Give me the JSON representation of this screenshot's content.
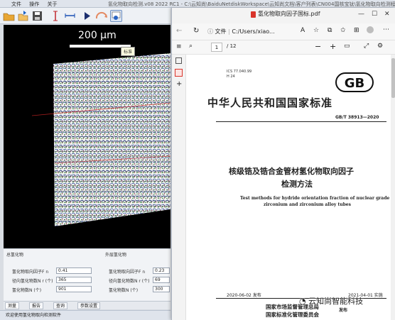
{
  "app": {
    "menu": [
      "文件",
      "操作",
      "关于"
    ],
    "title": "氢化物取向检测.v08 2022 RC1 - C:\\云知尚\\BaiduNetdiskWorkspace\\云知尚文档\\客户列表\\CN004国核宝钛\\氢化物取向检测程序RT...",
    "tooltip": "标准",
    "scalebar_label": "200 µm",
    "left_group": {
      "title": "总氢化物",
      "fields": [
        {
          "label": "氢化物取向因子F n",
          "value": "0.41"
        },
        {
          "label": "径向氢化物数N r (个)",
          "value": "365"
        },
        {
          "label": "氢化物数N (个)",
          "value": "901"
        }
      ]
    },
    "right_group": {
      "title": "外层氢化物",
      "fields": [
        {
          "label": "氢化物取向因子F n",
          "value": "0.23"
        },
        {
          "label": "径向氢化物数N r (个)",
          "value": "69"
        },
        {
          "label": "氢化物数N (个)",
          "value": "300"
        }
      ]
    },
    "bottom_tabs": [
      "测量",
      "报告",
      "查询",
      "参数设置"
    ],
    "status": "欢迎使用氢化物取向检测软件"
  },
  "browser": {
    "tab_title": "氢化物取向因子国标.pdf",
    "address_label": "文件",
    "address_path": "C:/Users/xiao...",
    "page_current": "1",
    "page_total": "/ 12"
  },
  "document": {
    "ics": "ICS 77.040.99",
    "ccs": "H 24",
    "logo": "GB",
    "standard_title": "中华人民共和国国家标准",
    "number": "GB/T 38913—2020",
    "title_line1": "核级锆及锆合金管材氢化物取向因子",
    "title_line2": "检测方法",
    "english_line1": "Test methods for hydride orientation fraction of nuclear grade",
    "english_line2": "zirconium and zirconium alloy tubes",
    "published": "2020-06-02 发布",
    "implemented": "2021-04-01 实施",
    "issuer1": "国家市场监督管理总局",
    "issuer2": "国家标准化管理委员会",
    "issuer_tag": "发布"
  },
  "watermark": "云知尚智能科技",
  "colors": {
    "accent": "#1a73e8",
    "pdf_icon": "#d9342b",
    "viewer_bg": "#000000"
  }
}
